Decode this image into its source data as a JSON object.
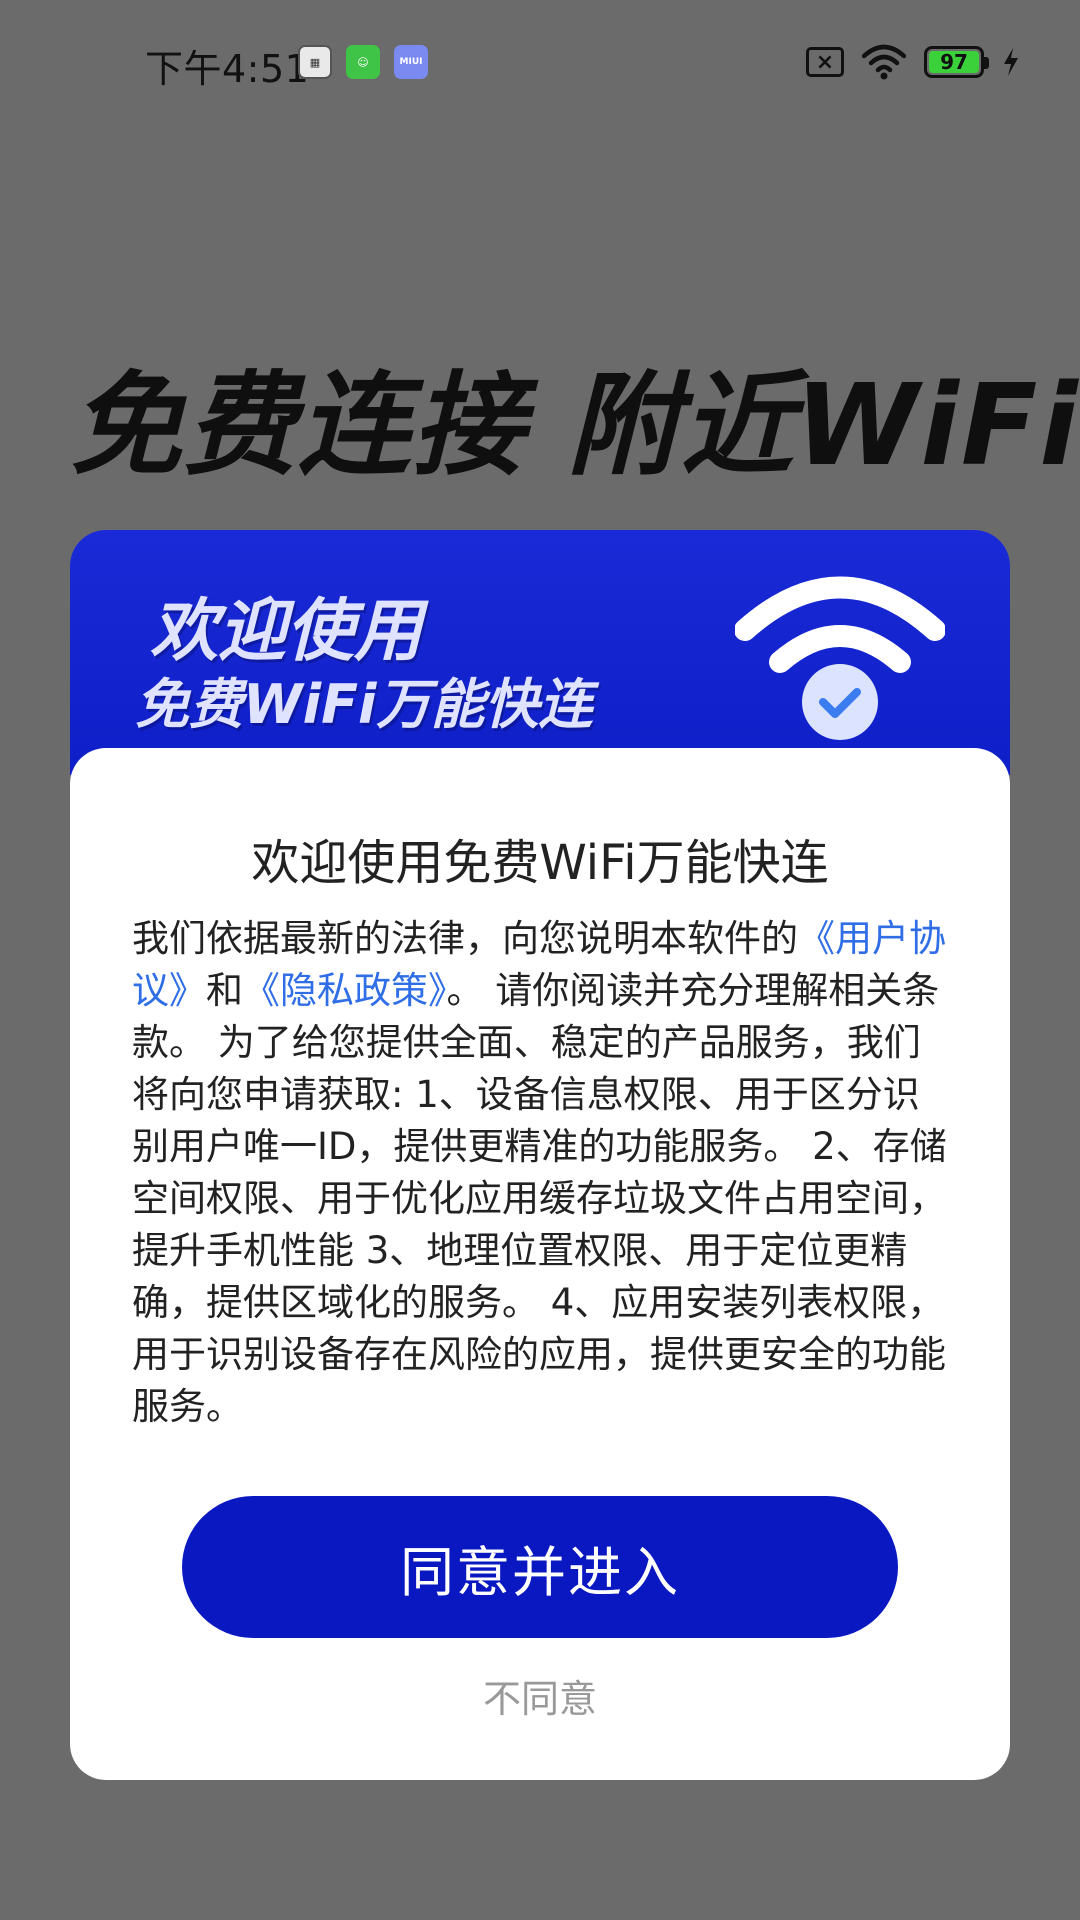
{
  "status_bar": {
    "time": "下午4:51",
    "battery": "97",
    "left_icons": [
      "calculator-icon",
      "green-app-icon",
      "miui-icon"
    ],
    "miui_label": "MIUI"
  },
  "hero": {
    "title": "免费连接  附近WiFi"
  },
  "dialog": {
    "header_line1": "欢迎使用",
    "header_line2": "免费WiFi万能快连",
    "title": "欢迎使用免费WiFi万能快连",
    "text_part1": "我们依据最新的法律，向您说明本软件的",
    "link_user_agreement": "《用户协议》",
    "text_and": "和",
    "link_privacy": "《隐私政策》",
    "text_part2": "。 请你阅读并充分理解相关条款。 为了给您提供全面、稳定的产品服务，我们将向您申请获取: 1、设备信息权限、用于区分识别用户唯一ID，提供更精准的功能服务。 2、存储空间权限、用于优化应用缓存垃圾文件占用空间，提升手机性能 3、地理位置权限、用于定位更精确，提供区域化的服务。 4、应用安装列表权限，用于识别设备存在风险的应用，提供更安全的功能服务。",
    "agree_label": "同意并进入",
    "disagree_label": "不同意"
  },
  "colors": {
    "primary": "#0a18c2",
    "link": "#2f6ee6",
    "overlay": "#6b6b6b"
  }
}
